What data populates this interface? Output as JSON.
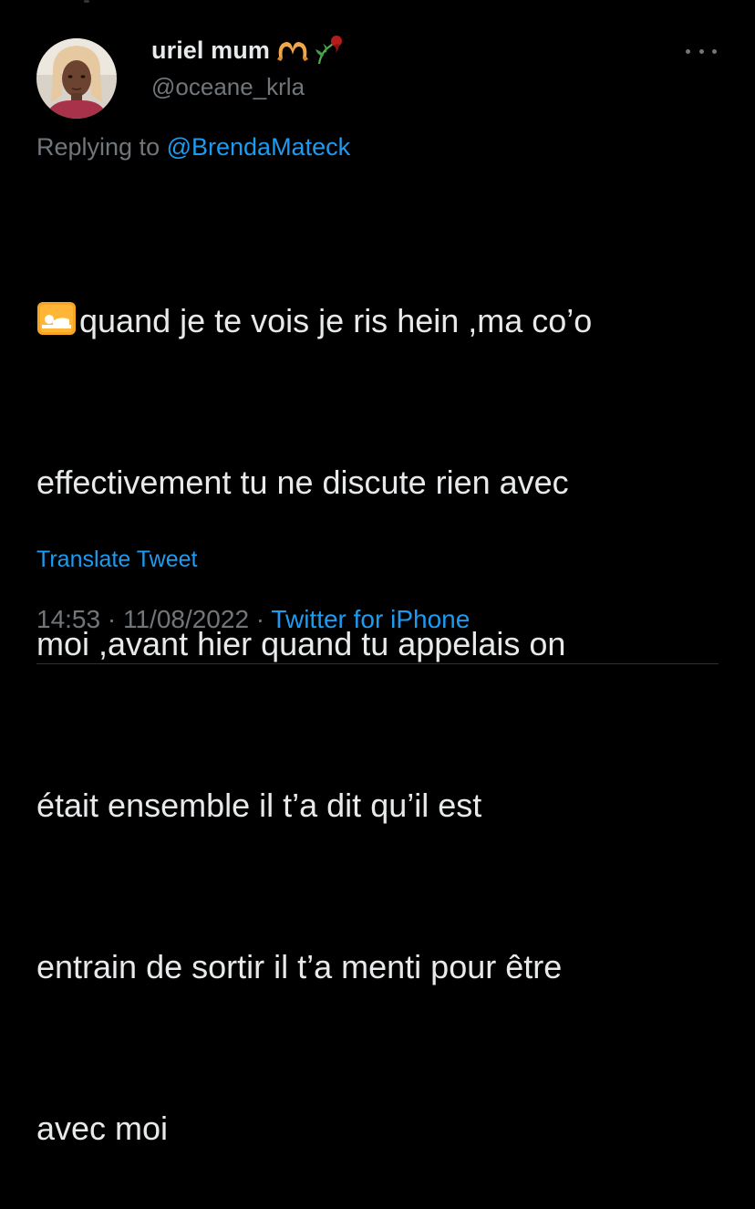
{
  "tweet": {
    "author": {
      "display_name": "uriel mum",
      "name_emojis": [
        "heart-hands-emoji",
        "wilted-rose-emoji"
      ],
      "handle": "@oceane_krla",
      "avatar": "profile-photo"
    },
    "reply_prefix": "Replying to ",
    "reply_to": "@BrendaMateck",
    "text_emoji": "sleeping-accommodation-emoji",
    "text_lines": [
      "quand je te vois je ris hein ,ma co’o",
      "effectivement tu ne discute rien avec",
      "moi ,avant hier quand tu appelais on",
      "était ensemble il t’a dit qu’il est",
      "entrain de sortir il t’a menti pour être",
      "avec moi"
    ],
    "translate_label": "Translate Tweet",
    "time": "14:53",
    "separator": " · ",
    "date": "11/08/2022",
    "source": "Twitter for iPhone",
    "more_icon": "more-options-icon"
  },
  "colors": {
    "background": "#000000",
    "primary_text": "#e7e9ea",
    "secondary_text": "#71767b",
    "link": "#1d9bf0",
    "divider": "#2f3336"
  }
}
